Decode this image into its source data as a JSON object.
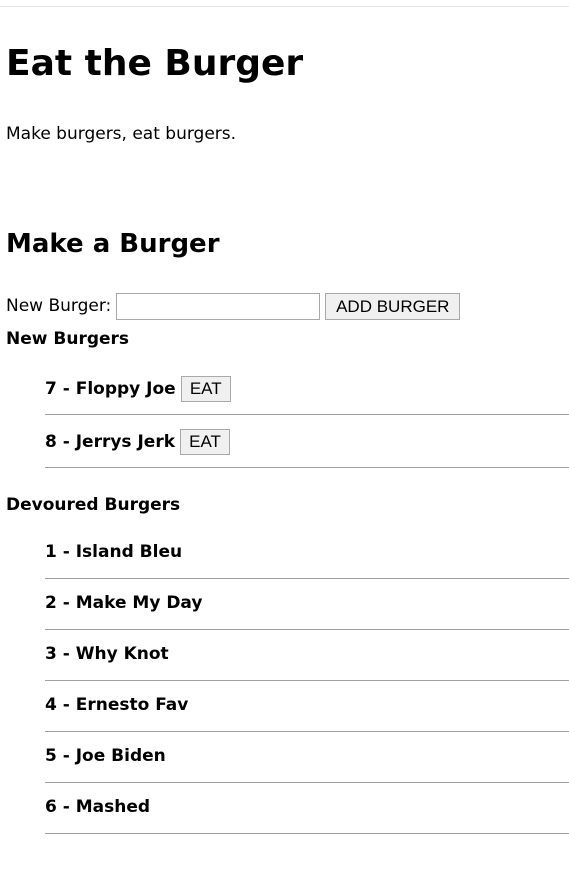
{
  "header": {
    "title": "Eat the Burger",
    "tagline": "Make burgers, eat burgers."
  },
  "make_section": {
    "title": "Make a Burger",
    "input_label": "New Burger:",
    "input_value": "",
    "input_placeholder": "",
    "add_button_label": "ADD BURGER"
  },
  "new_burgers": {
    "heading": "New Burgers",
    "items": [
      {
        "label": "7 - Floppy Joe",
        "button_label": "EAT"
      },
      {
        "label": "8 - Jerrys Jerk",
        "button_label": "EAT"
      }
    ]
  },
  "devoured_burgers": {
    "heading": "Devoured Burgers",
    "items": [
      {
        "label": "1 - Island Bleu"
      },
      {
        "label": "2 - Make My Day"
      },
      {
        "label": "3 - Why Knot"
      },
      {
        "label": "4 - Ernesto Fav"
      },
      {
        "label": "5 - Joe Biden"
      },
      {
        "label": "6 - Mashed"
      }
    ]
  }
}
